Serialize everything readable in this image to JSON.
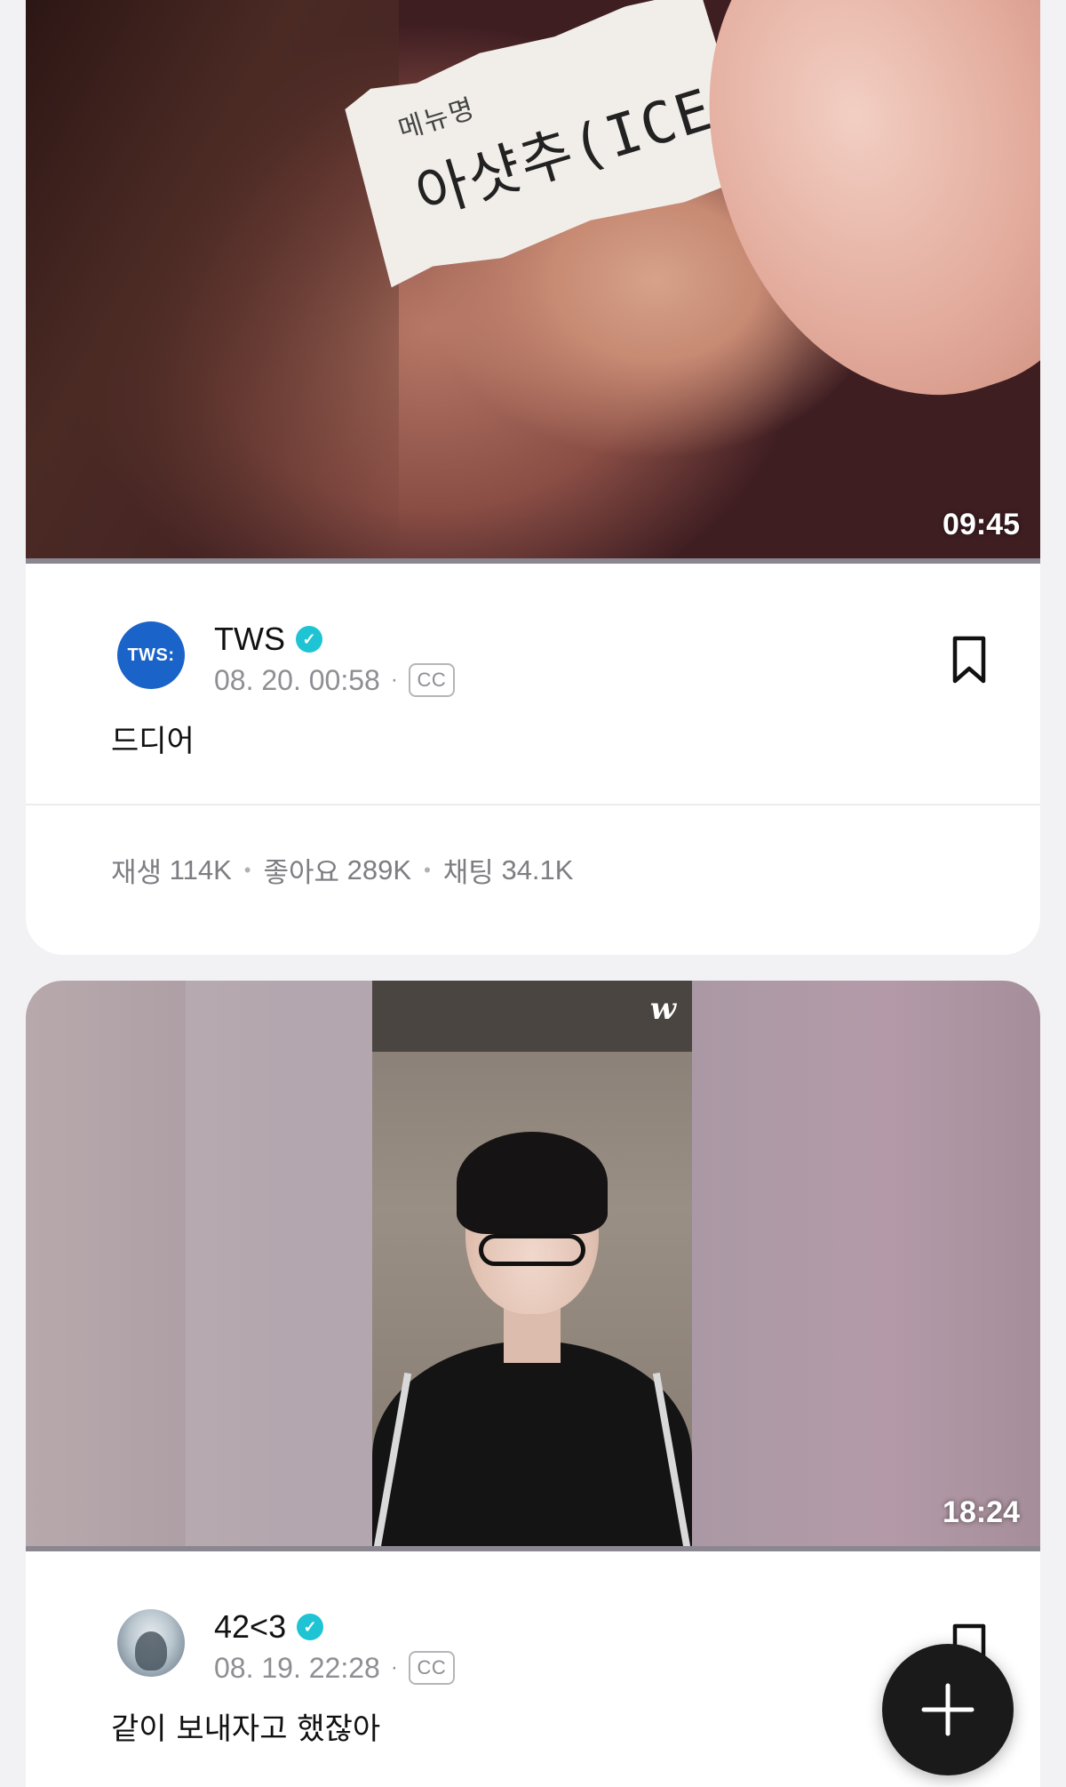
{
  "feed": {
    "posts": [
      {
        "thumbnail_text_top": "메뉴명",
        "thumbnail_text_main": "아샷추(ICE(50",
        "duration": "09:45",
        "progress": 1.0,
        "author": {
          "name": "TWS",
          "avatar_text": "TWS:",
          "verified": true
        },
        "date": "08. 20. 00:58",
        "cc_label": "CC",
        "caption": "드디어",
        "stats": {
          "plays_label": "재생",
          "plays": "114K",
          "likes_label": "좋아요",
          "likes": "289K",
          "chats_label": "채팅",
          "chats": "34.1K"
        }
      },
      {
        "thumbnail_logo": "w",
        "duration": "18:24",
        "progress": 1.0,
        "author": {
          "name": "42<3",
          "verified": true
        },
        "date": "08. 19. 22:28",
        "cc_label": "CC",
        "caption": "같이 보내자고 했잖아"
      }
    ]
  },
  "fab": {
    "icon": "plus-icon"
  },
  "colors": {
    "verified": "#1ec4d4",
    "tws_avatar": "#1a63c8",
    "fab": "#1a1a1a"
  }
}
